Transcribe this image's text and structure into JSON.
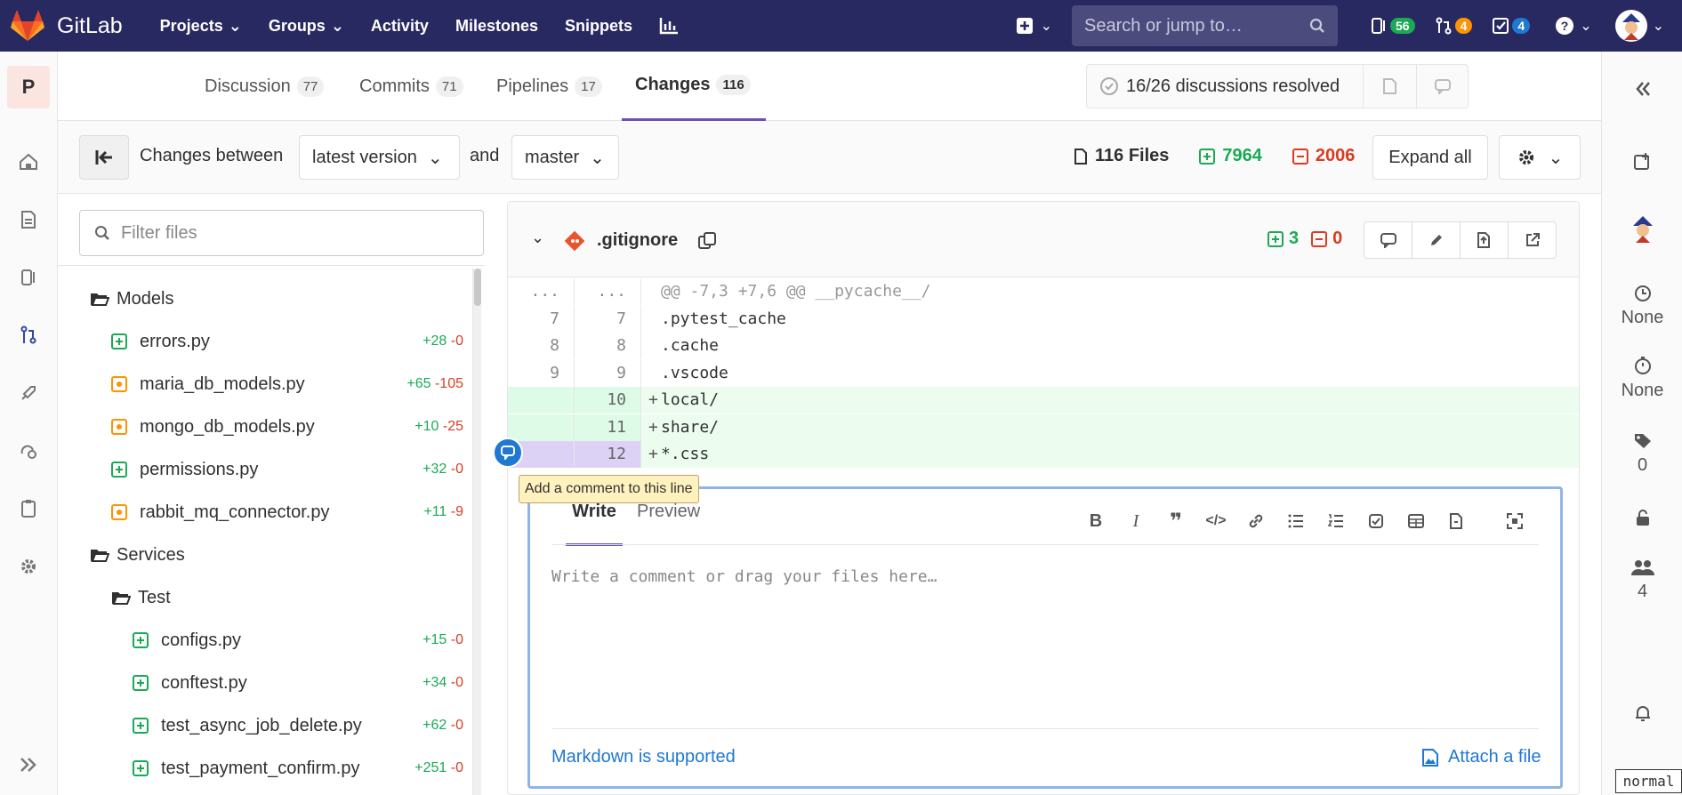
{
  "topnav": {
    "brand": "GitLab",
    "items": [
      "Projects",
      "Groups",
      "Activity",
      "Milestones",
      "Snippets"
    ],
    "search_placeholder": "Search or jump to…",
    "issues_count": "56",
    "mr_count": "4",
    "todos_count": "4",
    "colors": {
      "bg": "#292961",
      "issues_pill": "#1aaa55",
      "mr_pill": "#fc9403",
      "todos_pill": "#1f78d1"
    }
  },
  "leftbar": {
    "project_letter": "P",
    "icons": [
      "home-icon",
      "document-icon",
      "issues-icon",
      "merge-request-icon",
      "rocket-icon",
      "operations-icon",
      "clipboard-icon",
      "gear-icon",
      "expand-icon"
    ]
  },
  "tabs": [
    {
      "label": "Discussion",
      "count": "77"
    },
    {
      "label": "Commits",
      "count": "71"
    },
    {
      "label": "Pipelines",
      "count": "17"
    },
    {
      "label": "Changes",
      "count": "116"
    }
  ],
  "resolved": {
    "text": "16/26 discussions resolved"
  },
  "compare": {
    "prefix": "Changes between",
    "version": "latest version",
    "and": "and",
    "target": "master",
    "files": "116 Files",
    "additions": "7964",
    "deletions": "2006",
    "expand_all": "Expand all"
  },
  "filetree": {
    "filter_placeholder": "Filter files",
    "rows": [
      {
        "type": "folder",
        "name": "Models",
        "indent": 0
      },
      {
        "type": "added",
        "name": "errors.py",
        "add": "+28",
        "del": "-0",
        "indent": 1
      },
      {
        "type": "modified",
        "name": "maria_db_models.py",
        "add": "+65",
        "del": "-105",
        "indent": 1
      },
      {
        "type": "modified",
        "name": "mongo_db_models.py",
        "add": "+10",
        "del": "-25",
        "indent": 1
      },
      {
        "type": "added",
        "name": "permissions.py",
        "add": "+32",
        "del": "-0",
        "indent": 1
      },
      {
        "type": "modified",
        "name": "rabbit_mq_connector.py",
        "add": "+11",
        "del": "-9",
        "indent": 1
      },
      {
        "type": "folder",
        "name": "Services",
        "indent": 0
      },
      {
        "type": "folder",
        "name": "Test",
        "indent": 1
      },
      {
        "type": "added",
        "name": "configs.py",
        "add": "+15",
        "del": "-0",
        "indent": 2
      },
      {
        "type": "added",
        "name": "conftest.py",
        "add": "+34",
        "del": "-0",
        "indent": 2
      },
      {
        "type": "added",
        "name": "test_async_job_delete.py",
        "add": "+62",
        "del": "-0",
        "indent": 2
      },
      {
        "type": "added",
        "name": "test_payment_confirm.py",
        "add": "+251",
        "del": "-0",
        "indent": 2
      }
    ]
  },
  "diff": {
    "filename": ".gitignore",
    "additions": "3",
    "deletions": "0",
    "lines": [
      {
        "old": "...",
        "new": "...",
        "sign": "",
        "text": "@@ -7,3 +7,6 @@ __pycache__/",
        "kind": "hunk"
      },
      {
        "old": "7",
        "new": "7",
        "sign": "",
        "text": ".pytest_cache",
        "kind": "ctx"
      },
      {
        "old": "8",
        "new": "8",
        "sign": "",
        "text": ".cache",
        "kind": "ctx"
      },
      {
        "old": "9",
        "new": "9",
        "sign": "",
        "text": ".vscode",
        "kind": "ctx"
      },
      {
        "old": "",
        "new": "10",
        "sign": "+",
        "text": "local/",
        "kind": "add"
      },
      {
        "old": "",
        "new": "11",
        "sign": "+",
        "text": "share/",
        "kind": "add"
      },
      {
        "old": "",
        "new": "12",
        "sign": "+",
        "text": "*.css",
        "kind": "add-hl"
      }
    ],
    "tooltip": "Add a comment to this line"
  },
  "comment": {
    "write_tab": "Write",
    "preview_tab": "Preview",
    "placeholder": "Write a comment or drag your files here…",
    "markdown": "Markdown is supported",
    "attach": "Attach a file"
  },
  "rightbar": {
    "time_estimate": "None",
    "time_spent": "None",
    "labels": "0",
    "participants": "4"
  },
  "mode_indicator": "normal"
}
